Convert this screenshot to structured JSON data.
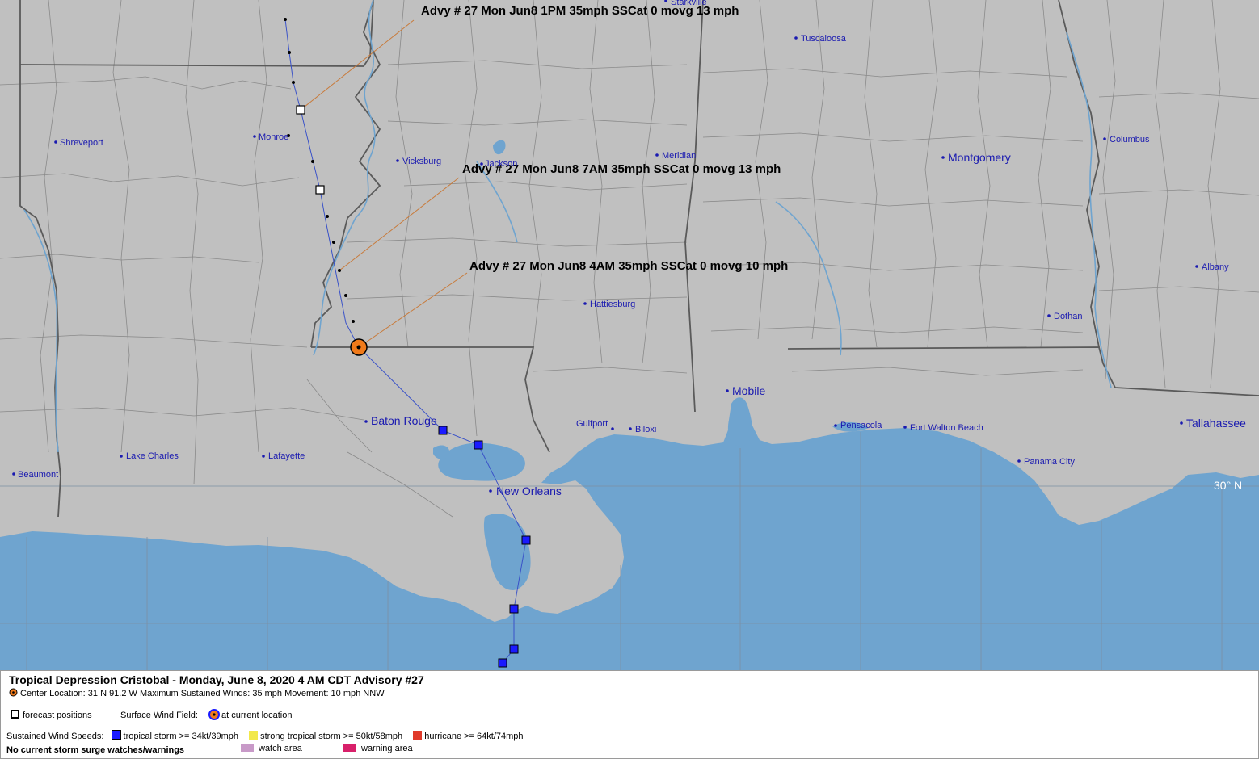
{
  "map": {
    "colors": {
      "land": "#c0c0c0",
      "water": "#6fa4cf",
      "county_line": "#8a8a8a",
      "state_line": "#5a5a5a",
      "grid": "#7d8fa3",
      "track": "#3a52c8",
      "callout": "#c87a3a",
      "city": "#1a1ab0"
    },
    "latitude_label": "30° N",
    "advisories": [
      {
        "id": "1pm",
        "text": "Advy # 27 Mon Jun8 1PM  35mph SSCat 0 movg 13 mph"
      },
      {
        "id": "7am",
        "text": "Advy # 27 Mon Jun8 7AM  35mph SSCat 0 movg 13 mph"
      },
      {
        "id": "4am",
        "text": "Advy # 27 Mon Jun8 4AM  35mph SSCat 0 movg 10 mph"
      }
    ],
    "cities": [
      {
        "name": "Shreveport",
        "big": false
      },
      {
        "name": "Monroe",
        "big": false
      },
      {
        "name": "Vicksburg",
        "big": false
      },
      {
        "name": "Jackson",
        "big": false
      },
      {
        "name": "Tuscaloosa",
        "big": false
      },
      {
        "name": "Starkville",
        "big": false
      },
      {
        "name": "Meridian",
        "big": false
      },
      {
        "name": "Montgomery",
        "big": true
      },
      {
        "name": "Columbus",
        "big": false
      },
      {
        "name": "Albany",
        "big": false
      },
      {
        "name": "Dothan",
        "big": false
      },
      {
        "name": "Hattiesburg",
        "big": false
      },
      {
        "name": "Mobile",
        "big": true
      },
      {
        "name": "Baton Rouge",
        "big": true
      },
      {
        "name": "Lake Charles",
        "big": false
      },
      {
        "name": "Lafayette",
        "big": false
      },
      {
        "name": "Beaumont",
        "big": false
      },
      {
        "name": "New Orleans",
        "big": true
      },
      {
        "name": "Gulfport",
        "big": false
      },
      {
        "name": "Biloxi",
        "big": false
      },
      {
        "name": "Pensacola",
        "big": false
      },
      {
        "name": "Fort Walton Beach",
        "big": false
      },
      {
        "name": "Panama City",
        "big": false
      },
      {
        "name": "Tallahassee",
        "big": true
      }
    ]
  },
  "legend": {
    "title": "Tropical Depression Cristobal  -  Monday, June 8, 2020  4 AM CDT   Advisory #27",
    "center_info": "Center Location: 31 N  91.2 W   Maximum Sustained Winds: 35 mph  Movement: 10 mph NNW",
    "forecast_positions": "forecast positions",
    "surface_wind_field": "Surface Wind Field:",
    "at_current_location": "at current location",
    "sustained_wind_speeds": "Sustained Wind Speeds:",
    "tropical_storm": "tropical storm >= 34kt/39mph",
    "strong_tropical_storm": "strong tropical storm >= 50kt/58mph",
    "hurricane": "hurricane >= 64kt/74mph",
    "storm_surge": "No current storm surge watches/warnings",
    "watch_area": "watch area",
    "warning_area": "warning area",
    "colors": {
      "tropical_storm": "#1a1aff",
      "strong_tropical_storm": "#f2e84a",
      "hurricane": "#e03a2a",
      "watch_area": "#c89ac8",
      "warning_area": "#d8206a",
      "center_marker": "#f07a1a"
    }
  }
}
